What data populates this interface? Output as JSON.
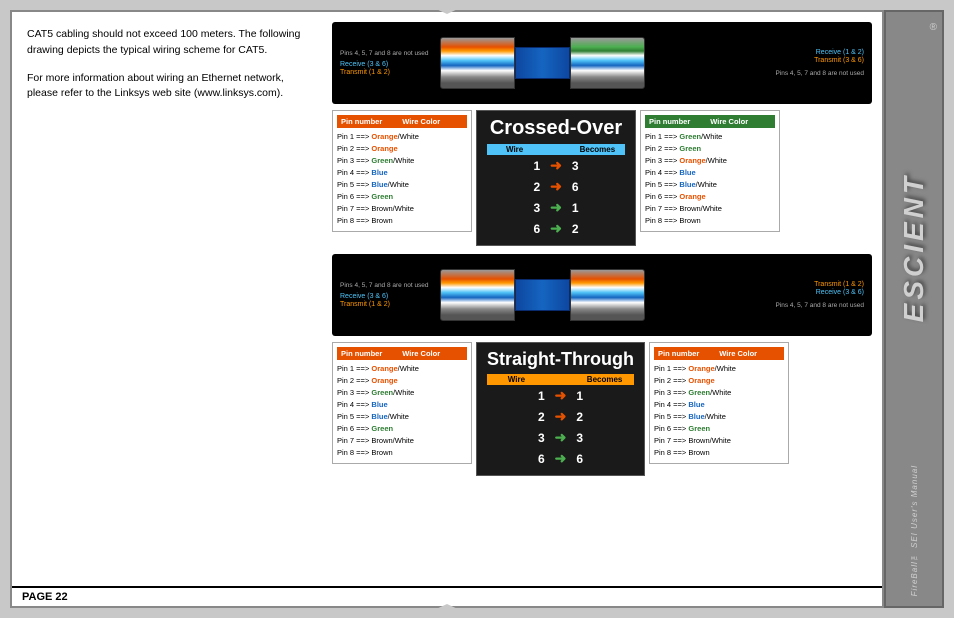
{
  "page": {
    "number": "PAGE 22",
    "left_text_1": "CAT5 cabling should not exceed 100 meters. The following drawing depicts the typical wiring scheme for CAT5.",
    "left_text_2": "For more information about wiring an Ethernet network, please refer to the Linksys web site (www.linksys.com)."
  },
  "crossed_over": {
    "title": "Crossed-Over",
    "header_wire": "Wire",
    "header_becomes": "Becomes",
    "rows": [
      {
        "wire": "1",
        "becomes": "3"
      },
      {
        "wire": "2",
        "becomes": "6"
      },
      {
        "wire": "3",
        "becomes": "1"
      },
      {
        "wire": "6",
        "becomes": "2"
      }
    ]
  },
  "straight_through": {
    "title": "Straight-Through",
    "header_wire": "Wire",
    "header_becomes": "Becomes",
    "rows": [
      {
        "wire": "1",
        "becomes": "1"
      },
      {
        "wire": "2",
        "becomes": "2"
      },
      {
        "wire": "3",
        "becomes": "3"
      },
      {
        "wire": "6",
        "becomes": "6"
      }
    ]
  },
  "pin_table_left_crossed": {
    "headers": [
      "Pin number",
      "Wire Color"
    ],
    "rows": [
      "Pin 1 ==> Orange/White",
      "Pin 2 ==> Orange",
      "Pin 3 ==> Green/White",
      "Pin 4 ==> Blue",
      "Pin 5 ==> Blue/White",
      "Pin 6 ==> Green",
      "Pin 7 ==> Brown/White",
      "Pin 8 ==> Brown"
    ]
  },
  "pin_table_right_crossed": {
    "headers": [
      "Pin number",
      "Wire Color"
    ],
    "rows": [
      "Pin 1 ==> Green/White",
      "Pin 2 ==> Green",
      "Pin 3 ==> Orange/White",
      "Pin 4 ==> Blue",
      "Pin 5 ==> Blue/White",
      "Pin 6 ==> Orange",
      "Pin 7 ==> Brown/White",
      "Pin 8 ==> Brown"
    ]
  },
  "pin_table_left_straight": {
    "headers": [
      "Pin number",
      "Wire Color"
    ],
    "rows": [
      "Pin 1 ==> Orange/White",
      "Pin 2 ==> Orange",
      "Pin 3 ==> Green/White",
      "Pin 4 ==> Blue",
      "Pin 5 ==> Blue/White",
      "Pin 6 ==> Green",
      "Pin 7 ==> Brown/White",
      "Pin 8 ==> Brown"
    ]
  },
  "pin_table_right_straight": {
    "headers": [
      "Pin number",
      "Wire Color"
    ],
    "rows": [
      "Pin 1 ==> Orange/White",
      "Pin 2 ==> Orange",
      "Pin 3 ==> Green/White",
      "Pin 4 ==> Blue",
      "Pin 5 ==> Blue/White",
      "Pin 6 ==> Green",
      "Pin 7 ==> Brown/White",
      "Pin 8 ==> Brown"
    ]
  },
  "wiring_1": {
    "pin_note_top": "Pins 4, 5, 7 and 8 are not used",
    "label_receive": "Receive (3 & 6)",
    "label_transmit": "Transmit (1 & 2)",
    "right_receive": "Receive (1 & 2)",
    "right_transmit": "Transmit (3 & 6)",
    "pin_note_bottom": "Pins 4, 5, 7 and 8 are not used"
  },
  "wiring_2": {
    "pin_note_top": "Pins 4, 5, 7 and 8 are not used",
    "label_receive": "Receive (3 & 6)",
    "label_transmit": "Transmit (1 & 2)",
    "right_transmit": "Transmit (1 & 2)",
    "right_receive": "Receive (3 & 6)",
    "pin_note_bottom": "Pins 4, 5, 7 and 8 are not used"
  },
  "sidebar": {
    "brand": "ESCIENT",
    "registered": "®",
    "subtitle": "FireBall™ SEI User's Manual"
  }
}
